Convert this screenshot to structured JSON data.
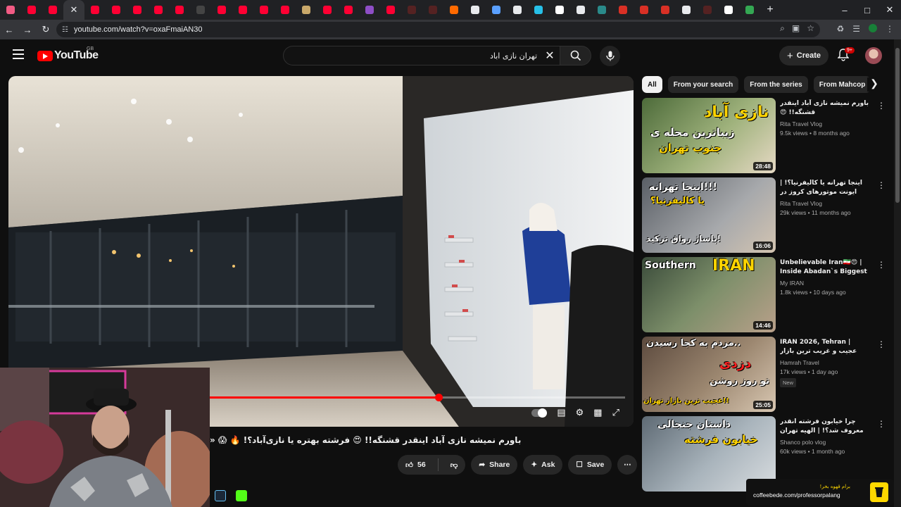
{
  "browser": {
    "tab_favicons": [
      "#f25b84",
      "#ff0033",
      "#ff0033",
      "#ff0033",
      "#ff0033",
      "#ff0033",
      "#ff0033",
      "#ff0033",
      "#ff0033",
      "#444444",
      "#ff0033",
      "#ff0033",
      "#ff0033",
      "#ff0033",
      "#c9a86a",
      "#ff0033",
      "#ff0033",
      "#8e4ec6",
      "#ff0033",
      "#552222",
      "#552222",
      "#ff6a00",
      "#e8eaed",
      "#5aa0ff",
      "#e8eaed",
      "#27c0e8",
      "#ffffff",
      "#e8eaed",
      "#2a8a8a",
      "#d93025",
      "#d93025",
      "#d93025",
      "#e8eaed",
      "#552222",
      "#ffffff",
      "#34a853"
    ],
    "active_tab_index": 3,
    "url": "youtube.com/watch?v=oxaFmaiAN30"
  },
  "header": {
    "logo_text": "YouTube",
    "region": "GB",
    "search_value": "تهران نازی اباد",
    "create_label": "Create",
    "notifications_badge": "9+"
  },
  "player": {
    "progress": 0.55
  },
  "video": {
    "title": "باورم نمیشه نازی آباد اینقدر قشنگه!! 😍 فرشته بهتره یا نازی‌آباد؟! 🔥 😱 «",
    "likes": "56",
    "share_label": "Share",
    "ask_label": "Ask",
    "save_label": "Save"
  },
  "chips": [
    {
      "label": "All",
      "active": true
    },
    {
      "label": "From your search",
      "active": false
    },
    {
      "label": "From the series",
      "active": false
    },
    {
      "label": "From Mahcop",
      "active": false
    }
  ],
  "recommendations": [
    {
      "title": "باورم نمیشه نازی آباد اینقدر قشنگه!! 😍",
      "rtl": true,
      "channel": "Rita Travel Vlog",
      "stats": "9.5k views • 8 months ago",
      "duration": "28:48",
      "thumb_text": [
        "نازی آباد",
        "زیباترین محله ی",
        "جنوب تهران"
      ]
    },
    {
      "title": "اینجا تهرانه یا کالیفرنیا؟! | ایونت موتورهای کروز در رواق مال 🔥 🚗",
      "rtl": true,
      "channel": "Rita Travel Vlog",
      "stats": "29k views • 11 months ago",
      "duration": "16:06",
      "thumb_text": [
        "اینجا تهرانه!!!",
        "یا کالیفرنیا؟",
        "پاساژ رواق ترکید!"
      ]
    },
    {
      "title": "Unbelievable Iran🇮🇷😍 | Inside Abadan`s Biggest ...",
      "rtl": false,
      "channel": "My IRAN",
      "stats": "1.8k views • 10 days ago",
      "duration": "14:46",
      "thumb_text": [
        "Southern",
        "IRAN"
      ]
    },
    {
      "title": "IRAN 2026, Tehran | عجیب و غریب ترین بازار تهران!! بلورکردینه",
      "rtl": false,
      "channel": "Hamrah Travel",
      "stats": "17k views • 1 day ago",
      "badge": "New",
      "duration": "25:05",
      "thumb_text": [
        "مردم به کجا رسیدن..",
        "دزدی",
        "تو روز روشن",
        "عجیب ترین بازار تهران!!"
      ]
    },
    {
      "title": "چرا خیابون فرشته انقدر معروف شد؟! | الهیه تهران",
      "rtl": true,
      "channel": "Shanco polo vlog",
      "stats": "60k views • 1 month ago",
      "duration": "",
      "thumb_text": [
        "داستان جنجالی",
        "خیابون فرشته"
      ]
    }
  ],
  "overlay": {
    "coffee_fa": "برام قهوه بخر!",
    "coffee_link": "coffeebede.com/professorpalang"
  }
}
